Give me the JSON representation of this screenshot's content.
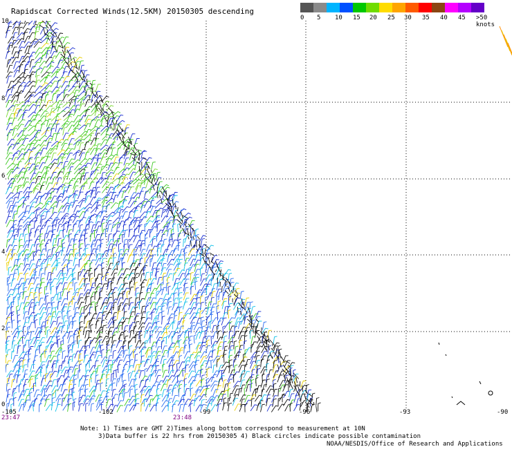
{
  "title": "Rapidscat Corrected Winds(12.5KM) 20150305 descending",
  "legend": {
    "colors": [
      "#555555",
      "#8a8a8a",
      "#00b4ff",
      "#0050ff",
      "#00c800",
      "#70dc00",
      "#ffdc00",
      "#ffa500",
      "#ff5a00",
      "#ff0000",
      "#8b4513",
      "#ff00ff",
      "#b400ff",
      "#6400c8"
    ],
    "labels": [
      "0",
      "5",
      "10",
      "15",
      "20",
      "25",
      "30",
      "35",
      "40",
      "45",
      ">50 knots"
    ]
  },
  "lat_labels": [
    "10",
    "8",
    "6",
    "4",
    "2",
    "0"
  ],
  "lon_labels": [
    "-105",
    "-102",
    "-99",
    "-96",
    "-93",
    "-90"
  ],
  "time_labels": [
    "23:47",
    "23:48"
  ],
  "note_line1": "Note: 1) Times are GMT 2)Times along bottom correspond to measurement at 10N",
  "note_line2": "3)Data buffer is 22 hrs from 20150305 4) Black circles indicate possible contamination",
  "credit": "NOAA/NESDIS/Office of Research and Applications"
}
